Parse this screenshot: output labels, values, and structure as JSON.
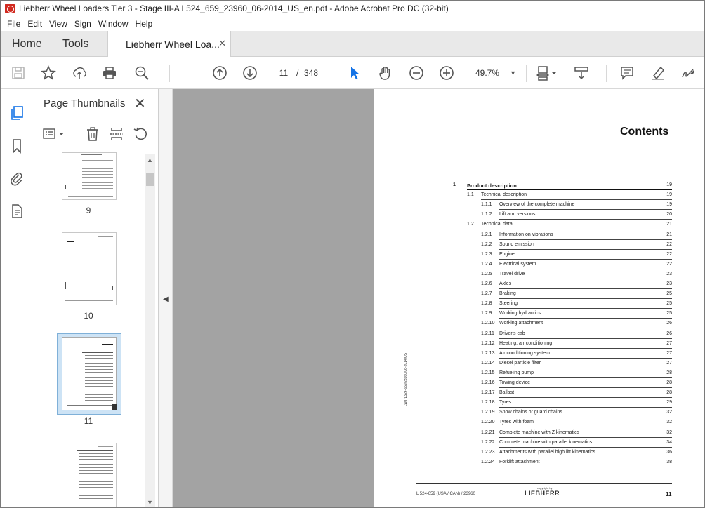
{
  "window": {
    "title": "Liebherr Wheel Loaders Tier 3 - Stage III-A L524_659_23960_06-2014_US_en.pdf - Adobe Acrobat Pro DC (32-bit)"
  },
  "menu": [
    "File",
    "Edit",
    "View",
    "Sign",
    "Window",
    "Help"
  ],
  "tabs": {
    "home": "Home",
    "tools": "Tools",
    "document": "Liebherr Wheel Loa...",
    "close": "✕"
  },
  "toolbar": {
    "current_page": "11",
    "separator": "/",
    "total_pages": "348",
    "zoom": "49.7%",
    "icons": [
      "save-icon",
      "bookmark-star-icon",
      "upload-icon",
      "print-icon",
      "search-zoom-icon",
      "prev-page-icon",
      "next-page-icon",
      "select-cursor-icon",
      "hand-icon",
      "zoom-out-icon",
      "zoom-in-icon",
      "fit-page-icon",
      "scroll-mode-icon",
      "comment-icon",
      "highlight-icon",
      "sign-icon"
    ]
  },
  "sidebar": {
    "title": "Page Thumbnails",
    "close": "✕",
    "thumbnails": [
      {
        "label": "9"
      },
      {
        "label": "10"
      },
      {
        "label": "11",
        "selected": true
      },
      {
        "label": ""
      }
    ]
  },
  "document": {
    "heading": "Contents",
    "toc": [
      {
        "num": "1",
        "title": "Product description",
        "page": "19",
        "level": 0
      },
      {
        "num": "1.1",
        "title": "Technical description",
        "page": "19",
        "level": 1
      },
      {
        "num": "1.1.1",
        "title": "Overview of the complete machine",
        "page": "19",
        "level": 2
      },
      {
        "num": "1.1.2",
        "title": "Lift arm versions",
        "page": "20",
        "level": 2
      },
      {
        "num": "1.2",
        "title": "Technical data",
        "page": "21",
        "level": 1
      },
      {
        "num": "1.2.1",
        "title": "Information on vibrations",
        "page": "21",
        "level": 2
      },
      {
        "num": "1.2.2",
        "title": "Sound emission",
        "page": "22",
        "level": 2
      },
      {
        "num": "1.2.3",
        "title": "Engine",
        "page": "22",
        "level": 2
      },
      {
        "num": "1.2.4",
        "title": "Electrical system",
        "page": "22",
        "level": 2
      },
      {
        "num": "1.2.5",
        "title": "Travel drive",
        "page": "23",
        "level": 2
      },
      {
        "num": "1.2.6",
        "title": "Axles",
        "page": "23",
        "level": 2
      },
      {
        "num": "1.2.7",
        "title": "Braking",
        "page": "25",
        "level": 2
      },
      {
        "num": "1.2.8",
        "title": "Steering",
        "page": "25",
        "level": 2
      },
      {
        "num": "1.2.9",
        "title": "Working hydraulics",
        "page": "25",
        "level": 2
      },
      {
        "num": "1.2.10",
        "title": "Working attachment",
        "page": "26",
        "level": 2
      },
      {
        "num": "1.2.11",
        "title": "Driver's cab",
        "page": "26",
        "level": 2
      },
      {
        "num": "1.2.12",
        "title": "Heating, air conditioning",
        "page": "27",
        "level": 2
      },
      {
        "num": "1.2.13",
        "title": "Air conditioning system",
        "page": "27",
        "level": 2
      },
      {
        "num": "1.2.14",
        "title": "Diesel particle filter",
        "page": "27",
        "level": 2
      },
      {
        "num": "1.2.15",
        "title": "Refueling pump",
        "page": "28",
        "level": 2
      },
      {
        "num": "1.2.16",
        "title": "Towing device",
        "page": "28",
        "level": 2
      },
      {
        "num": "1.2.17",
        "title": "Ballast",
        "page": "28",
        "level": 2
      },
      {
        "num": "1.2.18",
        "title": "Tyres",
        "page": "29",
        "level": 2
      },
      {
        "num": "1.2.19",
        "title": "Snow chains or guard chains",
        "page": "32",
        "level": 2
      },
      {
        "num": "1.2.20",
        "title": "Tyres with foam",
        "page": "32",
        "level": 2
      },
      {
        "num": "1.2.21",
        "title": "Complete machine with Z kinematics",
        "page": "32",
        "level": 2
      },
      {
        "num": "1.2.22",
        "title": "Complete machine with parallel kinematics",
        "page": "34",
        "level": 2
      },
      {
        "num": "1.2.23",
        "title": "Attachments with parallel high lift kinematics",
        "page": "36",
        "level": 2
      },
      {
        "num": "1.2.24",
        "title": "Forklift attachment",
        "page": "38",
        "level": 2
      }
    ],
    "side_text": "LWT/L524-659/23960/06-2014/US",
    "footer_left": "L 524-659 (USA / CAN) / 23960",
    "footer_copy": "copyright by",
    "footer_brand": "LIEBHERR",
    "footer_page": "11"
  },
  "colors": {
    "accent": "#1473e6",
    "doc_background": "#a3a3a3",
    "thumb_selected": "#cde3f5"
  }
}
